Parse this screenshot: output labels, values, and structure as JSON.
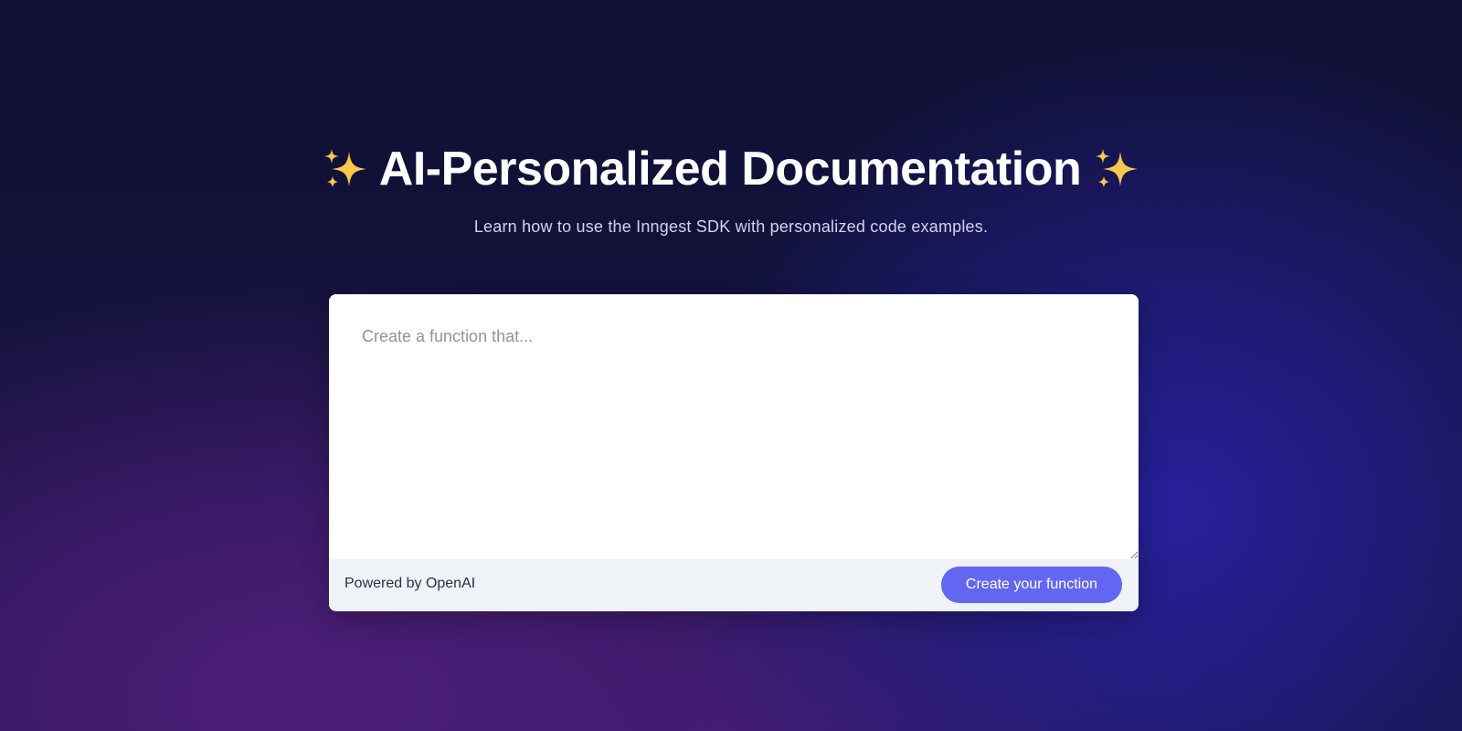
{
  "hero": {
    "title": "AI-Personalized Documentation",
    "title_icons": [
      "sparkles-icon",
      "sparkles-icon"
    ],
    "subtitle": "Learn how to use the Inngest SDK with personalized code examples."
  },
  "form": {
    "placeholder": "Create a function that...",
    "value": "",
    "powered_by": "Powered by OpenAI",
    "submit_label": "Create your function"
  },
  "colors": {
    "background": "#12123a",
    "accent": "#6366f1",
    "sparkle": "#f6c84c",
    "footer_bg": "#eff3f8"
  }
}
